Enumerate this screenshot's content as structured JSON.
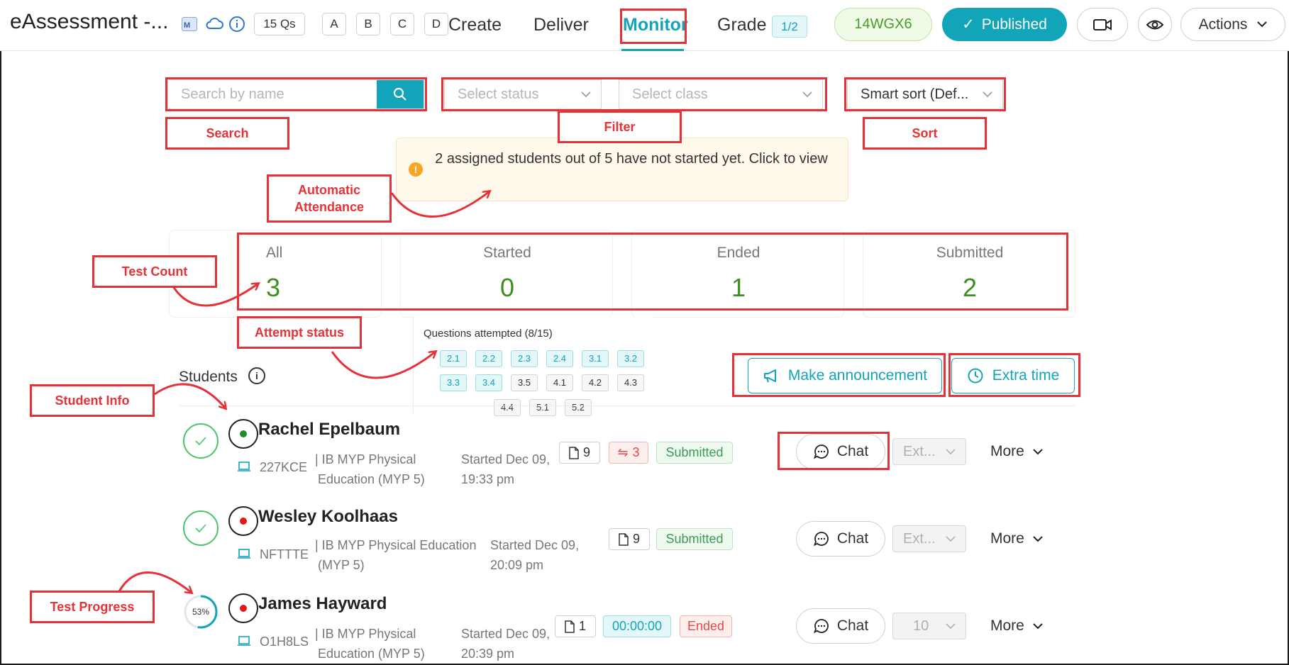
{
  "header": {
    "app_title": "eAssessment -...",
    "question_count": "15 Qs",
    "option_tags": [
      "A",
      "B",
      "C",
      "D"
    ],
    "tabs": [
      "Create",
      "Deliver",
      "Monitor",
      "Grade"
    ],
    "grade_badge": "1/2",
    "session_code": "14WGX6",
    "published_label": "Published",
    "actions_label": "Actions"
  },
  "filters": {
    "search_placeholder": "Search by name",
    "status_placeholder": "Select status",
    "class_placeholder": "Select class",
    "sort_value": "Smart sort (Def..."
  },
  "notice": {
    "text": "2 assigned students out of 5 have not started yet. Click to view"
  },
  "counts": [
    {
      "label": "All",
      "value": "3"
    },
    {
      "label": "Started",
      "value": "0"
    },
    {
      "label": "Ended",
      "value": "1"
    },
    {
      "label": "Submitted",
      "value": "2"
    }
  ],
  "attempt": {
    "title": "Questions attempted (8/15)",
    "questions": [
      {
        "id": "2.1",
        "done": true
      },
      {
        "id": "2.2",
        "done": true
      },
      {
        "id": "2.3",
        "done": true
      },
      {
        "id": "2.4",
        "done": true
      },
      {
        "id": "3.1",
        "done": true
      },
      {
        "id": "3.2",
        "done": true
      },
      {
        "id": "3.3",
        "done": true
      },
      {
        "id": "3.4",
        "done": true
      },
      {
        "id": "3.5",
        "done": false
      },
      {
        "id": "4.1",
        "done": false
      },
      {
        "id": "4.2",
        "done": false
      },
      {
        "id": "4.3",
        "done": false
      },
      {
        "id": "4.4",
        "done": false
      },
      {
        "id": "5.1",
        "done": false
      },
      {
        "id": "5.2",
        "done": false
      }
    ]
  },
  "students_section": {
    "title": "Students",
    "announce_label": "Make announcement",
    "extra_time_label": "Extra time"
  },
  "students": [
    {
      "name": "Rachel Epelbaum",
      "code": "227KCE",
      "class_line1": "| IB MYP Physical",
      "class_line2": "Education (MYP 5)",
      "started_line1": "Started Dec 09,",
      "started_line2": "19:33 pm",
      "doc_count": "9",
      "swap_count": "3",
      "status": "Submitted",
      "chat_label": "Chat",
      "ext_value": "Ext...",
      "more_label": "More",
      "dot_color": "#1e8a2a"
    },
    {
      "name": "Wesley Koolhaas",
      "code": "NFTTTE",
      "class_line1": "| IB MYP Physical Education",
      "class_line2": "(MYP 5)",
      "started_line1": "Started Dec 09,",
      "started_line2": "20:09 pm",
      "doc_count": "9",
      "status": "Submitted",
      "chat_label": "Chat",
      "ext_value": "Ext...",
      "more_label": "More",
      "dot_color": "#e01919"
    },
    {
      "name": "James Hayward",
      "code": "O1H8LS",
      "class_line1": "| IB MYP Physical",
      "class_line2": "Education (MYP 5)",
      "started_line1": "Started Dec 09,",
      "started_line2": "20:39 pm",
      "doc_count": "1",
      "timer": "00:00:00",
      "status": "Ended",
      "chat_label": "Chat",
      "ext_value": "10",
      "more_label": "More",
      "progress_label": "53%",
      "progress": 0.53,
      "dot_color": "#e01919"
    }
  ],
  "annotations": {
    "search": "Search",
    "filter": "Filter",
    "sort": "Sort",
    "attendance_line1": "Automatic",
    "attendance_line2": "Attendance",
    "test_count": "Test Count",
    "attempt_status": "Attempt status",
    "student_info": "Student Info",
    "test_progress": "Test Progress"
  },
  "colors": {
    "accent": "#12a4b9",
    "annotation": "#e53238",
    "count_value": "#3e8e1f"
  }
}
